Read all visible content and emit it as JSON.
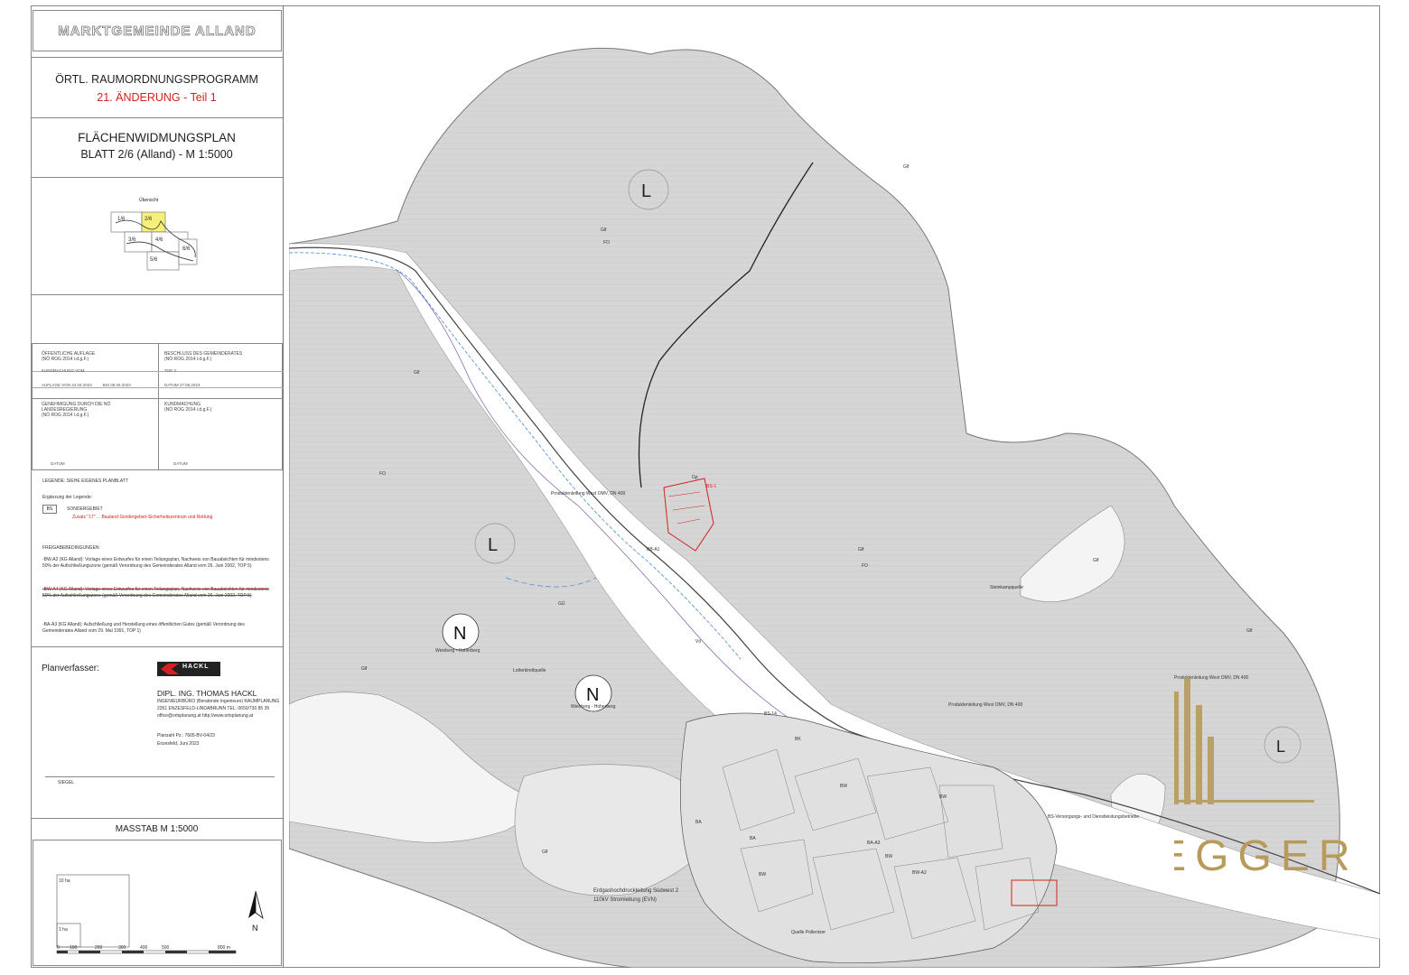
{
  "municipality": "MARKTGEMEINDE ALLAND",
  "program": {
    "title": "ÖRTL. RAUMORDNUNGSPROGRAMM",
    "amendment": "21. ÄNDERUNG - Teil 1"
  },
  "plan": {
    "title": "FLÄCHENWIDMUNGSPLAN",
    "sheet": "BLATT 2/6 (Alland)  -  M 1:5000"
  },
  "overview": {
    "label": "Übersicht",
    "sheets": [
      "1/6",
      "2/6",
      "3/6",
      "4/6",
      "5/6",
      "6/6"
    ],
    "highlight_color": "#f5f07a"
  },
  "approvals": {
    "public_display": {
      "title": "ÖFFENTLICHE AUFLAGE",
      "law": "(NÖ ROG 2014 i.d.g.F.)",
      "line1": "KUNDMACHUNG VOM",
      "from": "AUFLAGE   VON   24.04.2023",
      "to": "BIS   05.06.2023"
    },
    "council": {
      "title": "BESCHLUSS DES GEMEINDERATES",
      "law": "(NÖ ROG 2014 i.d.g.F.)",
      "top": "TOP   3",
      "date": "DATUM   27.06.2023"
    },
    "approval": {
      "title": "GENEHMIGUNG DURCH DIE NÖ LANDESREGIERUNG",
      "law": "(NÖ ROG 2014 i.d.g.F.)",
      "date_label": "DATUM"
    },
    "publication": {
      "title": "KUNDMACHUNG",
      "law": "(NÖ ROG 2014 i.d.g.F.)",
      "date_label": "DATUM"
    }
  },
  "legend": {
    "note": "LEGENDE: SIEHE EIGENES PLANBLATT",
    "supplement": "Ergänzung der Legende:",
    "code": "BS",
    "code_label": "SONDERGEBIET",
    "red_note": "Zusatz \"17\"  ... Bauland-Sondergebiet-Sicherheitszentrum und Rettung",
    "conditions_title": "FREIGABEBEDINGUNGEN:",
    "conditions": [
      "-BW-A2 (KG Alland): Vorlage eines Entwurfes für einen Teilungsplan, Nachweis von Bauabsichten für mindestens 50% der Aufschließungszone (gemäß Verordnung des Gemeinderates Alland vom 26. Juni 2002, TOP 5)",
      "-BW-A4 (KG Alland): Vorlage eines Entwurfes für einen Teilungsplan, Nachweis von Bauabsichten für mindestens 50% der Aufschließungszone (gemäß Verordnung des Gemeinderates Alland vom 26. Juni 2002, TOP 5)",
      "-BA-A3 (KG Alland): Aufschließung und Herstellung eines öffentlichen Gutes (gemäß Verordnung des Gemeinderates Alland vom 29. Mai 1991, TOP 1)"
    ]
  },
  "author": {
    "label": "Planverfasser:",
    "logo_text": "HACKL",
    "name": "DIPL. ING. THOMAS HACKL",
    "line1": "INGENIEURBÜRO (Beratende Ingenieure) RAUMPLANUNG",
    "line2": "2351 ENZESFELD-LINDABRUNN TEL. 0650/730 85 35",
    "line3": "office@ortsplanung.at       http://www.ortsplanung.at",
    "plan_no": "Planzahl Pz.: 7605-BV-04/23",
    "place_date": "Enzesfeld, Juni 2023",
    "sign": "SIEGEL"
  },
  "scale": {
    "title": "MASSTAB    M 1:5000",
    "area_big": "10 ha",
    "area_small": "1 ha",
    "ticks": [
      "0",
      "100",
      "200",
      "300",
      "400",
      "500",
      "800 m"
    ],
    "north": "N"
  },
  "map": {
    "zone_letters": [
      "L",
      "L",
      "L",
      "N",
      "N"
    ],
    "labels": [
      "Weinberg - Hoherberg",
      "Weinberg - Hoherberg",
      "Lotterkindlquelle",
      "Steinkampquelle",
      "Quelle Pollentzer",
      "Produktenleitung West OMV, DN 400",
      "Produktenleitung West OMV, DN 400",
      "Produktenleitung West OMV, DN 400",
      "Erdgashochdruckleitung Südwest 2",
      "110kV Stromleitung (EVN)",
      "BS-Versorgungs- und Dienstleistungsbetriebe",
      "Glf",
      "Glf",
      "Glf",
      "Glf",
      "Glf",
      "Glf",
      "Glf",
      "Glf",
      "FO",
      "FO",
      "FO",
      "GÜ",
      "BW",
      "BW",
      "BW",
      "BW",
      "BA",
      "BA",
      "BK",
      "BS-1",
      "BS-14",
      "BW-A2",
      "BA-A3",
      "BB-A1",
      "Gp",
      "Vö"
    ]
  },
  "watermark": {
    "text": "KALTENEGGER",
    "color": "#b89a5a"
  }
}
